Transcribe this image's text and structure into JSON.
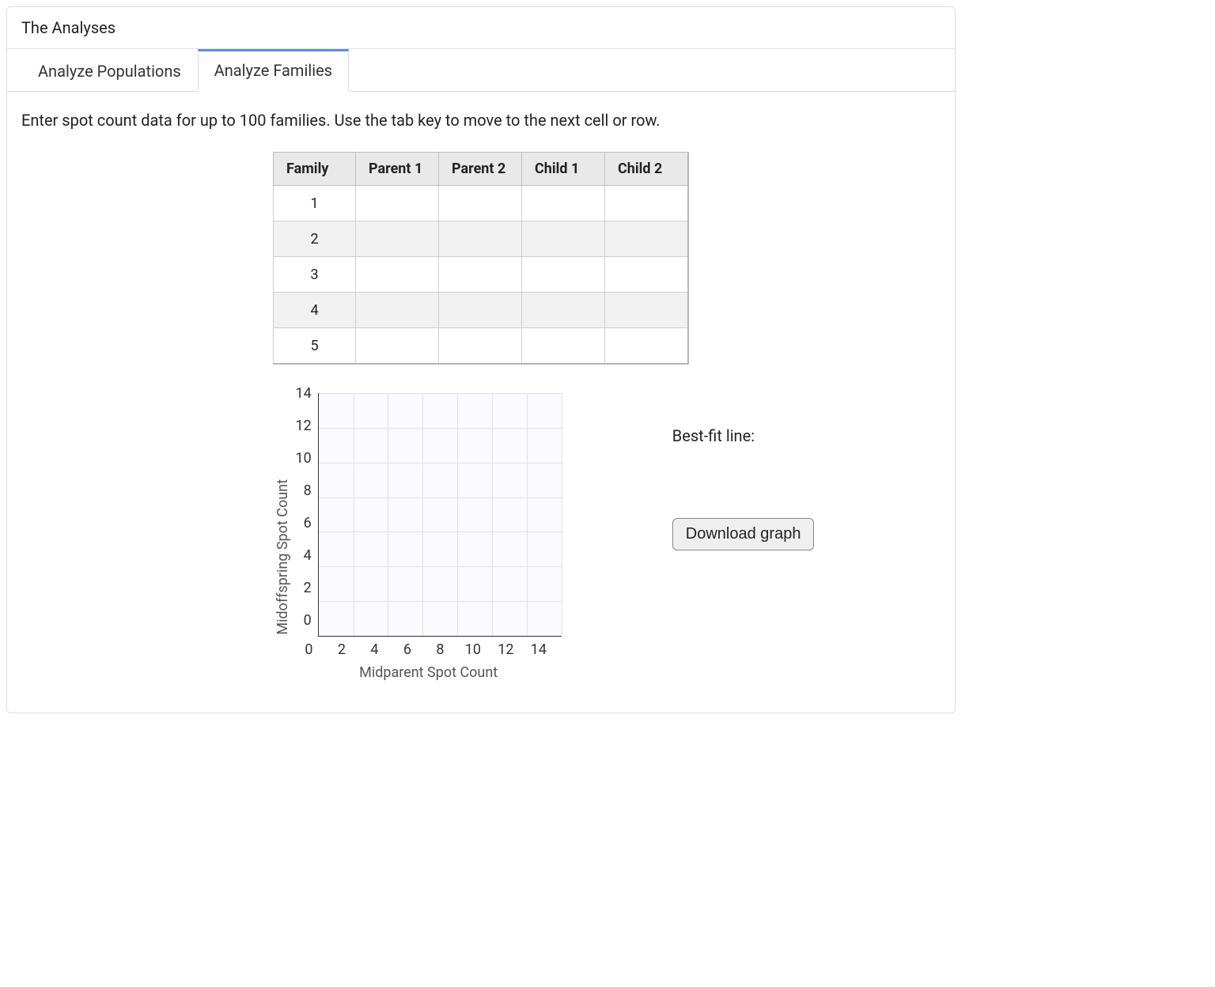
{
  "panel_title": "The Analyses",
  "tabs": [
    {
      "label": "Analyze Populations",
      "active": false
    },
    {
      "label": "Analyze Families",
      "active": true
    }
  ],
  "instructions": "Enter spot count data for up to 100 families. Use the tab key to move to the next cell or row.",
  "table": {
    "headers": [
      "Family",
      "Parent 1",
      "Parent 2",
      "Child 1",
      "Child 2"
    ],
    "rows": [
      {
        "family": "1",
        "parent1": "",
        "parent2": "",
        "child1": "",
        "child2": ""
      },
      {
        "family": "2",
        "parent1": "",
        "parent2": "",
        "child1": "",
        "child2": ""
      },
      {
        "family": "3",
        "parent1": "",
        "parent2": "",
        "child1": "",
        "child2": ""
      },
      {
        "family": "4",
        "parent1": "",
        "parent2": "",
        "child1": "",
        "child2": ""
      },
      {
        "family": "5",
        "parent1": "",
        "parent2": "",
        "child1": "",
        "child2": ""
      }
    ]
  },
  "chart_data": {
    "type": "scatter",
    "title": "",
    "xlabel": "Midparent Spot Count",
    "ylabel": "Midoffspring Spot Count",
    "x_ticks": [
      "0",
      "2",
      "4",
      "6",
      "8",
      "10",
      "12",
      "14"
    ],
    "y_ticks": [
      "14",
      "12",
      "10",
      "8",
      "6",
      "4",
      "2",
      "0"
    ],
    "xlim": [
      0,
      14
    ],
    "ylim": [
      0,
      14
    ],
    "series": []
  },
  "right": {
    "best_fit_label": "Best-fit line:",
    "download_label": "Download graph"
  }
}
